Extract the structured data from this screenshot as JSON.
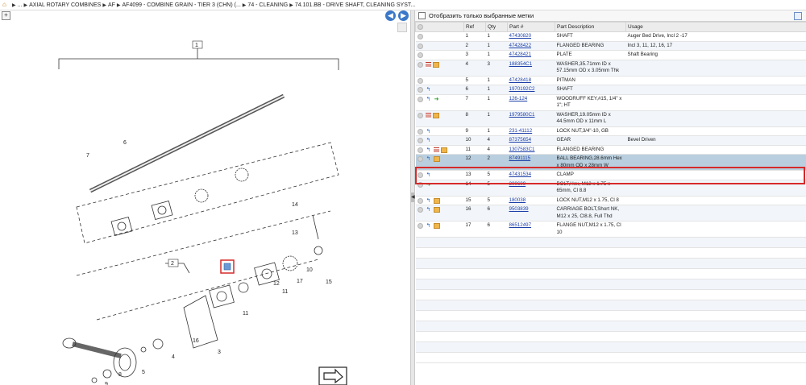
{
  "breadcrumb": {
    "home_icon": "home-icon",
    "items": [
      "...",
      "AXIAL ROTARY COMBINES",
      "AF",
      "AF4099 - COMBINE GRAIN - TIER 3 (CHN) (...",
      "74 - CLEANING",
      "74.101.BB - DRIVE SHAFT, CLEANING SYST..."
    ]
  },
  "left_toolbar": {
    "zoom_label": "+",
    "prev_icon": "arrow-left-icon",
    "next_icon": "arrow-right-icon"
  },
  "diagram": {
    "callouts": [
      "1",
      "2",
      "3",
      "4",
      "5",
      "6",
      "7",
      "8",
      "9",
      "10",
      "11",
      "11",
      "12",
      "13",
      "14",
      "15",
      "16",
      "17"
    ],
    "return_icon": "return-arrow-icon"
  },
  "filter": {
    "label": "Отобразить только выбранные метки",
    "checked": false
  },
  "table": {
    "headers": [
      "",
      "Ref",
      "Qty",
      "Part #",
      "Part Description",
      "Usage"
    ],
    "rows": [
      {
        "ref": "1",
        "qty": "1",
        "part": "47430820",
        "desc": "SHAFT",
        "usage": "Auger Bed Drive, Incl 2 -17",
        "icons": []
      },
      {
        "ref": "2",
        "qty": "1",
        "part": "47428422",
        "desc": "FLANGED BEARING",
        "usage": "Incl 3, 11, 12, 16, 17",
        "icons": []
      },
      {
        "ref": "3",
        "qty": "1",
        "part": "47428421",
        "desc": "PLATE",
        "usage": "Shaft Bearing",
        "icons": []
      },
      {
        "ref": "4",
        "qty": "3",
        "part": "188354C1",
        "desc": "WASHER,35.71mm ID x 57.15mm OD x 3.05mm Thk",
        "usage": "",
        "icons": [
          "list",
          "box"
        ]
      },
      {
        "ref": "5",
        "qty": "1",
        "part": "47428418",
        "desc": "PITMAN",
        "usage": "",
        "icons": []
      },
      {
        "ref": "6",
        "qty": "1",
        "part": "1970192C2",
        "desc": "SHAFT",
        "usage": "",
        "icons": [
          "blue"
        ]
      },
      {
        "ref": "7",
        "qty": "1",
        "part": "126-124",
        "desc": "WOODRUFF KEY,#15, 1/4\" x 1\"; HT",
        "usage": "",
        "icons": [
          "blue",
          "green"
        ]
      },
      {
        "ref": "8",
        "qty": "1",
        "part": "1979580C1",
        "desc": "WASHER,19.05mm ID x 44.5mm OD x 11mm L",
        "usage": "",
        "icons": [
          "list",
          "box"
        ]
      },
      {
        "ref": "9",
        "qty": "1",
        "part": "231-41112",
        "desc": "LOCK NUT,3/4\"-10, GB",
        "usage": "",
        "icons": [
          "blue"
        ]
      },
      {
        "ref": "10",
        "qty": "4",
        "part": "87375654",
        "desc": "GEAR",
        "usage": "Bevel Driven",
        "icons": [
          "blue"
        ]
      },
      {
        "ref": "11",
        "qty": "4",
        "part": "1307583C1",
        "desc": "FLANGED BEARING",
        "usage": "",
        "icons": [
          "blue",
          "list",
          "box"
        ]
      },
      {
        "ref": "12",
        "qty": "2",
        "part": "87491115",
        "desc": "BALL BEARING,28.6mm Hex x 80mm OD x 28mm W",
        "usage": "",
        "icons": [
          "blue",
          "box"
        ],
        "selected": true
      },
      {
        "ref": "13",
        "qty": "5",
        "part": "47431534",
        "desc": "CLAMP",
        "usage": "",
        "icons": [
          "blue"
        ]
      },
      {
        "ref": "14",
        "qty": "5",
        "part": "300609",
        "desc": "BOLT,Hex, M12 x 1.75 x 65mm, Cl 8.8",
        "usage": "",
        "icons": [
          "green"
        ]
      },
      {
        "ref": "15",
        "qty": "5",
        "part": "180038",
        "desc": "LOCK NUT,M12 x 1.75, Cl 8",
        "usage": "",
        "icons": [
          "blue",
          "box"
        ]
      },
      {
        "ref": "16",
        "qty": "6",
        "part": "9503839",
        "desc": "CARRIAGE BOLT,Short NK, M12 x 25, Cl8.8, Full Thd",
        "usage": "",
        "icons": [
          "blue",
          "box"
        ]
      },
      {
        "ref": "17",
        "qty": "6",
        "part": "86512497",
        "desc": "FLANGE NUT,M12 x 1.75, Cl 10",
        "usage": "",
        "icons": [
          "blue",
          "box"
        ]
      }
    ]
  },
  "colors": {
    "selected_row": "#b9cfdf",
    "highlight_border": "#d62a2a",
    "link": "#1b3ea8",
    "nav_button": "#3b78c8"
  }
}
